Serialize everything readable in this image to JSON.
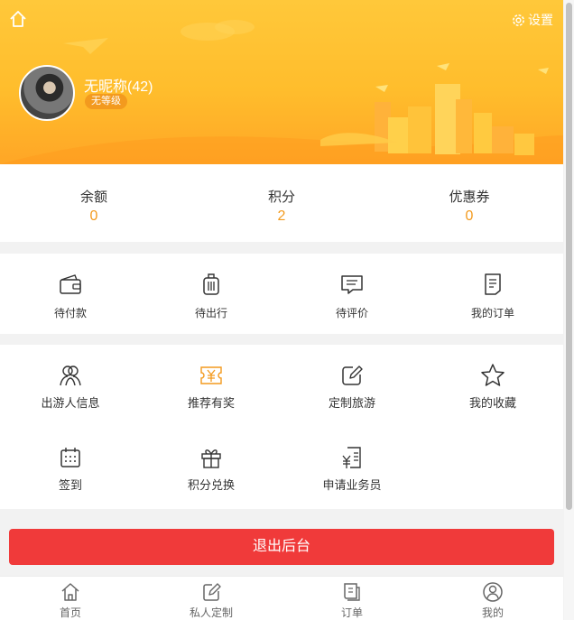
{
  "header": {
    "settings_label": "设置",
    "nickname": "无昵称(42)",
    "level": "无等级",
    "colors": {
      "gradient_top": "#ffc83a",
      "gradient_bottom": "#ffa626",
      "badge": "#f39a1e"
    }
  },
  "stats": [
    {
      "label": "余额",
      "value": "0"
    },
    {
      "label": "积分",
      "value": "2"
    },
    {
      "label": "优惠券",
      "value": "0"
    }
  ],
  "orders": [
    {
      "label": "待付款",
      "icon": "wallet-icon"
    },
    {
      "label": "待出行",
      "icon": "luggage-icon"
    },
    {
      "label": "待评价",
      "icon": "comment-icon"
    },
    {
      "label": "我的订单",
      "icon": "order-list-icon"
    }
  ],
  "services": [
    {
      "label": "出游人信息",
      "icon": "travelers-icon"
    },
    {
      "label": "推荐有奖",
      "icon": "reward-ticket-icon"
    },
    {
      "label": "定制旅游",
      "icon": "edit-icon"
    },
    {
      "label": "我的收藏",
      "icon": "star-icon"
    },
    {
      "label": "签到",
      "icon": "calendar-icon"
    },
    {
      "label": "积分兑换",
      "icon": "gift-icon"
    },
    {
      "label": "申请业务员",
      "icon": "application-icon"
    }
  ],
  "logout_label": "退出后台",
  "tabbar": [
    {
      "label": "首页",
      "icon": "home-icon"
    },
    {
      "label": "私人定制",
      "icon": "edit-icon"
    },
    {
      "label": "订单",
      "icon": "order-icon"
    },
    {
      "label": "我的",
      "icon": "user-icon"
    }
  ],
  "colors": {
    "accent_orange": "#f39a1e",
    "logout_red": "#f03a3a",
    "background": "#f2f2f2"
  }
}
